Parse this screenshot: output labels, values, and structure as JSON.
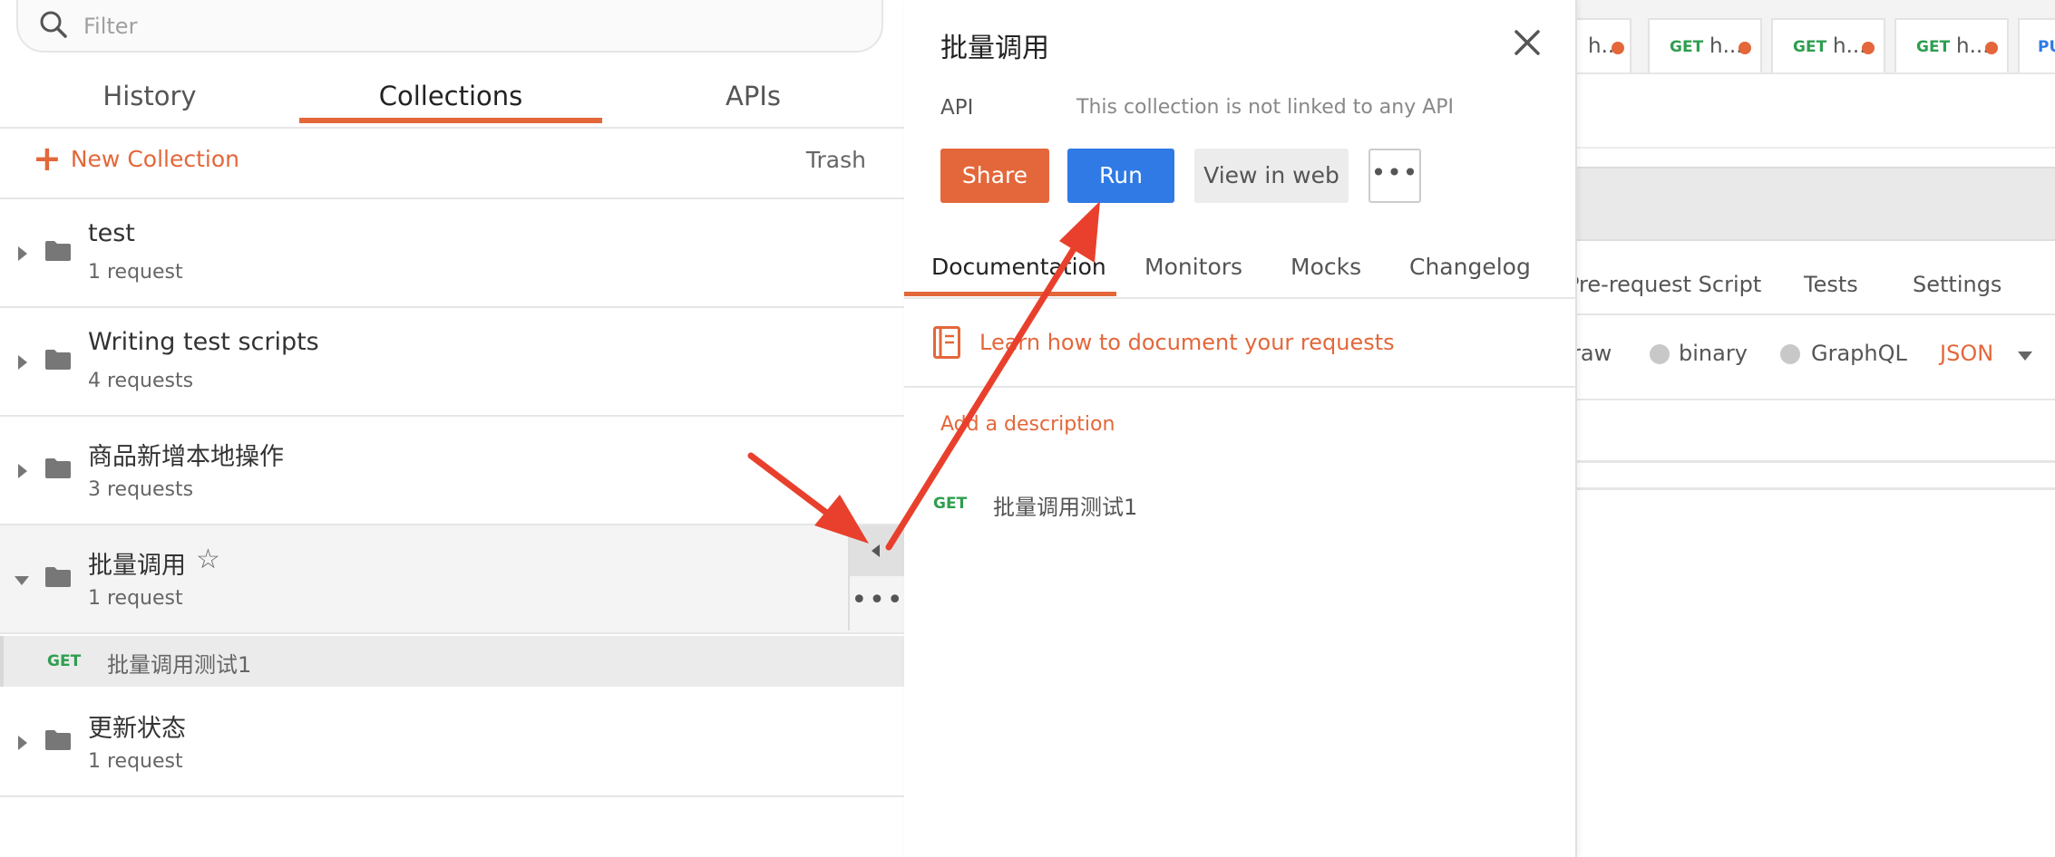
{
  "sidebar": {
    "filter_placeholder": "Filter",
    "tabs": [
      "History",
      "Collections",
      "APIs"
    ],
    "active_tab": "Collections",
    "new_collection_label": "New Collection",
    "trash_label": "Trash",
    "collections": [
      {
        "name": "test",
        "count": "1 request"
      },
      {
        "name": "Writing test scripts",
        "count": "4 requests"
      },
      {
        "name": "商品新增本地操作",
        "count": "3 requests"
      },
      {
        "name": "批量调用",
        "count": "1 request",
        "expanded": true
      },
      {
        "name": "更新状态",
        "count": "1 request"
      }
    ],
    "expanded_request": {
      "method": "GET",
      "name": "批量调用测试1"
    }
  },
  "panel": {
    "title": "批量调用",
    "api_label": "API",
    "api_text": "This collection is not linked to any API",
    "share_label": "Share",
    "run_label": "Run",
    "view_web_label": "View in web",
    "more_label": "•••",
    "tabs": [
      "Documentation",
      "Monitors",
      "Mocks",
      "Changelog"
    ],
    "learn_link": "Learn how to document your requests",
    "add_description": "Add a description",
    "request": {
      "method": "GET",
      "name": "批量调用测试1"
    }
  },
  "background": {
    "request_tabs": [
      {
        "method": "",
        "text": "h..."
      },
      {
        "method": "GET",
        "text": "h..."
      },
      {
        "method": "GET",
        "text": "h..."
      },
      {
        "method": "GET",
        "text": "h..."
      },
      {
        "method": "PU",
        "text": ""
      }
    ],
    "sub_tabs": [
      "Pre-request Script",
      "Tests",
      "Settings"
    ],
    "body_options": [
      "raw",
      "binary",
      "GraphQL",
      "JSON"
    ]
  },
  "colors": {
    "accent": "#e3673a",
    "run_blue": "#2f7ae5",
    "get_green": "#2e9e4f",
    "arrow_red": "#e8402c"
  }
}
